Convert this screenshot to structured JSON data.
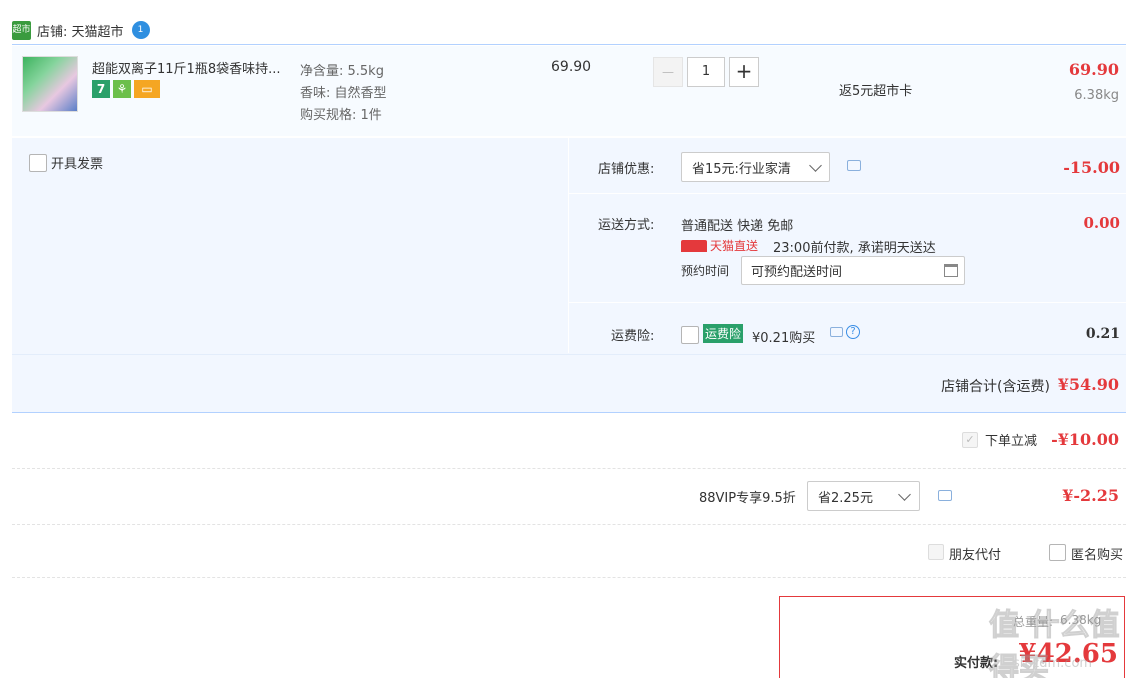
{
  "colors": {
    "accent_red": "#e4393c",
    "bg_blue": "#f2f7ff",
    "tmall_green": "#0eb83a"
  },
  "shop": {
    "name": "店铺: 天猫超市",
    "badge_icon": "supermarket-icon",
    "badge_text": "超市",
    "wangwang_icon": "chat-bubble-icon"
  },
  "item": {
    "title": "超能双离子11斤1瓶8袋香味持...",
    "attrs": [
      "净含量: 5.5kg",
      "香味: 自然香型",
      "购买规格: 1件"
    ],
    "unit_price": "69.90",
    "quantity": "1",
    "decrease": "—",
    "increase": "+",
    "promo": "返5元超市卡",
    "total": "69.90",
    "weight": "6.38kg",
    "service_badges": [
      "7",
      "⚘",
      "▭"
    ]
  },
  "invoice": {
    "label": "开具发票"
  },
  "shop_discount": {
    "label": "店铺优惠:",
    "selected": "省15元:行业家清",
    "amount": "-15.00"
  },
  "delivery": {
    "label": "运送方式:",
    "method": "普通配送 快递 免邮",
    "tmall_direct": "天猫直送",
    "promise": "23:00前付款, 承诺明天送达",
    "schedule_label": "预约时间",
    "schedule_placeholder": "可预约配送时间",
    "amount": "0.00"
  },
  "insurance": {
    "label": "运费险:",
    "tag": "运费险",
    "price": "¥0.21购买",
    "amount": "0.21"
  },
  "shop_total": {
    "label": "店铺合计(含运费)",
    "amount": "¥54.90"
  },
  "instant_discount": {
    "label": "下单立减",
    "amount": "-¥10.00"
  },
  "vip": {
    "label": "88VIP专享9.5折",
    "selected": "省2.25元",
    "amount": "¥-2.25"
  },
  "options": {
    "friend_pay": "朋友代付",
    "anonymous": "匿名购买"
  },
  "summary": {
    "weight_label": "总重量:",
    "weight_value": "6.38kg",
    "pay_label": "实付款:",
    "pay_amount": "¥42.65"
  },
  "watermark": {
    "text": "值 什么值得买",
    "sub": "smzdm.com"
  }
}
